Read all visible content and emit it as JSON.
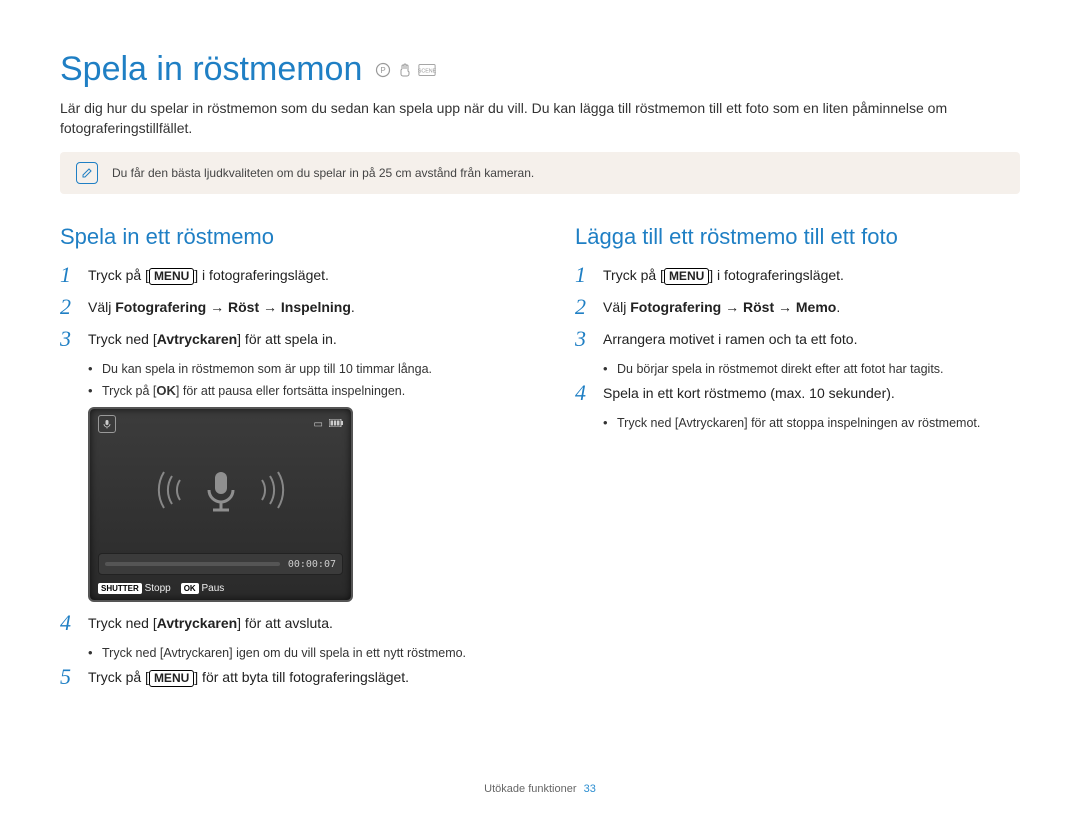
{
  "title": "Spela in röstmemon",
  "intro": "Lär dig hur du spelar in röstmemon som du sedan kan spela upp när du vill. Du kan lägga till röstmemon till ett foto som en liten påminnelse om fotograferingstillfället.",
  "tip": "Du får den bästa ljudkvaliteten om du spelar in på 25 cm avstånd från kameran.",
  "keys": {
    "menu": "MENU",
    "ok": "OK"
  },
  "left": {
    "heading": "Spela in ett röstmemo",
    "steps": [
      {
        "num": "1",
        "pre": "Tryck på [",
        "key": "MENU",
        "post": "] i fotograferingsläget."
      },
      {
        "num": "2",
        "text_parts": [
          "Välj ",
          "Fotografering → Röst → Inspelning",
          "."
        ]
      },
      {
        "num": "3",
        "text_parts": [
          "Tryck ned [",
          "Avtryckaren",
          "] för att spela in."
        ]
      }
    ],
    "sub_after_3": [
      "Du kan spela in röstmemon som är upp till 10 timmar långa.",
      "Tryck på [OK] för att pausa eller fortsätta inspelningen."
    ],
    "screen": {
      "time": "00:00:07",
      "stop_key": "SHUTTER",
      "stop_label": "Stopp",
      "paus_key": "OK",
      "paus_label": "Paus"
    },
    "step4": {
      "num": "4",
      "text_parts": [
        "Tryck ned [",
        "Avtryckaren",
        "] för att avsluta."
      ]
    },
    "sub_after_4": [
      "Tryck ned [Avtryckaren] igen om du vill spela in ett nytt röstmemo."
    ],
    "step5": {
      "num": "5",
      "pre": "Tryck på [",
      "key": "MENU",
      "post": "] för att byta till fotograferingsläget."
    }
  },
  "right": {
    "heading": "Lägga till ett röstmemo till ett foto",
    "steps": [
      {
        "num": "1",
        "pre": "Tryck på [",
        "key": "MENU",
        "post": "] i fotograferingsläget."
      },
      {
        "num": "2",
        "text_parts": [
          "Välj ",
          "Fotografering → Röst → Memo",
          "."
        ]
      },
      {
        "num": "3",
        "plain": "Arrangera motivet i ramen och ta ett foto."
      }
    ],
    "sub_after_3": [
      "Du börjar spela in röstmemot direkt efter att fotot har tagits."
    ],
    "step4": {
      "num": "4",
      "plain": "Spela in ett kort röstmemo (max. 10 sekunder)."
    },
    "sub_after_4": [
      "Tryck ned [Avtryckaren] för att stoppa inspelningen av röstmemot."
    ]
  },
  "footer": {
    "section": "Utökade funktioner",
    "page": "33"
  }
}
